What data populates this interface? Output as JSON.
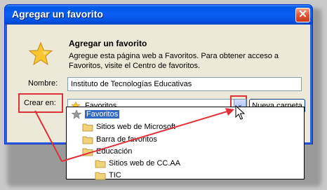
{
  "window": {
    "title": "Agregar un favorito",
    "close_label": "✕"
  },
  "dialog": {
    "heading": "Agregar un favorito",
    "description": "Agregue esta página web a Favoritos. Para obtener acceso a Favoritos, visite el Centro de favoritos.",
    "nombre_label": "Nombre:",
    "nombre_value": "Instituto de Tecnologías Educativas",
    "crear_label": "Crear en:",
    "crear_value": "Favoritos",
    "dropdown_arrow": "⌄",
    "nueva_carpeta_label": "Nueva carpeta"
  },
  "folder_tree": [
    {
      "label": "Favoritos",
      "selected": true
    },
    {
      "label": "Sitios web de Microsoft",
      "selected": false
    },
    {
      "label": "Barra de favoritos",
      "selected": false
    },
    {
      "label": "Educación",
      "selected": false
    },
    {
      "label": "Sitios web de CC.AA",
      "selected": false
    },
    {
      "label": "TIC",
      "selected": false
    }
  ],
  "colors": {
    "highlight": "#e0303a",
    "selection": "#316ac5",
    "titlebar": "#0a5ff0"
  }
}
